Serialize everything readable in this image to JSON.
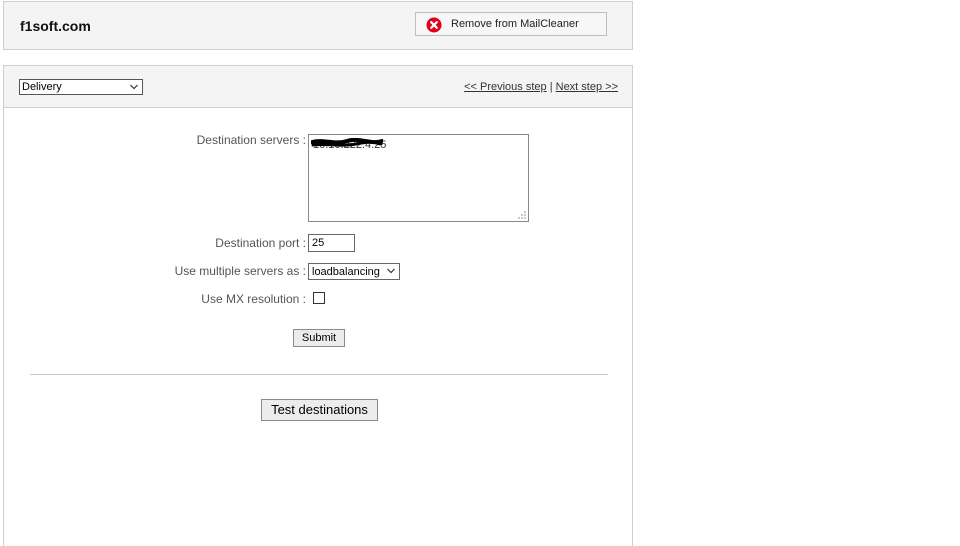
{
  "header": {
    "domain": "f1soft.com",
    "remove_button": {
      "label": "Remove from MailCleaner",
      "icon": "remove-circle-icon",
      "icon_color": "#e0001b"
    }
  },
  "panel": {
    "step_select": {
      "value": "Delivery"
    },
    "nav": {
      "previous": "<< Previous step",
      "separator": "|",
      "next": "Next step >>"
    },
    "form": {
      "destination_servers": {
        "label": "Destination servers :",
        "value": "10.10.222.4:25"
      },
      "destination_port": {
        "label": "Destination port :",
        "value": "25"
      },
      "multiple_servers": {
        "label": "Use multiple servers as :",
        "value": "loadbalancing"
      },
      "mx_resolution": {
        "label": "Use MX resolution :",
        "checked": false
      },
      "submit_label": "Submit"
    },
    "test_destinations_label": "Test destinations"
  }
}
